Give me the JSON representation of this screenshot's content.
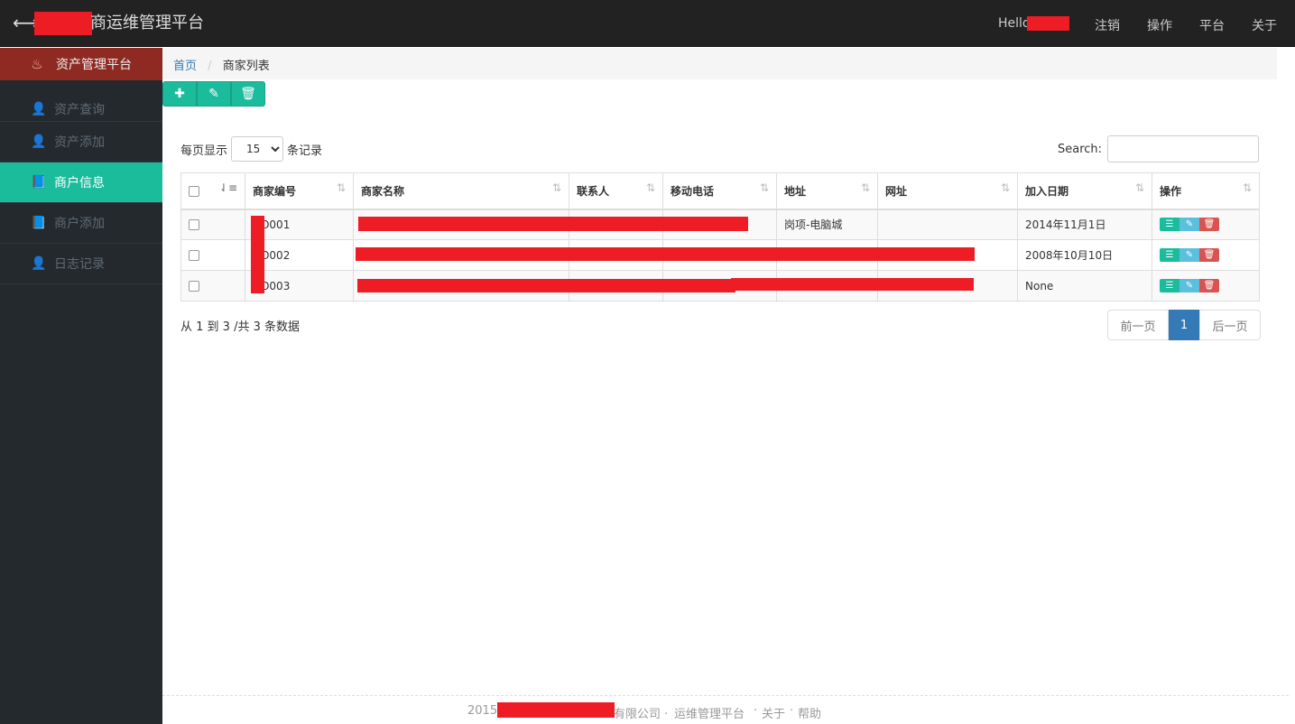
{
  "navbar": {
    "toggle_icon": "arrows-h-icon",
    "brand": "商运维管理平台",
    "hello": "Hello",
    "items": [
      "注销",
      "操作",
      "平台",
      "关于"
    ]
  },
  "sidebar": {
    "header": {
      "label": "资产管理平台",
      "icon": "fire-icon"
    },
    "items": [
      {
        "label": "资产查询",
        "icon": "user-icon"
      },
      {
        "label": "资产添加",
        "icon": "user-icon"
      },
      {
        "label": "商户信息",
        "icon": "book-icon",
        "active": true
      },
      {
        "label": "商户添加",
        "icon": "book-icon"
      },
      {
        "label": "日志记录",
        "icon": "user-icon"
      }
    ]
  },
  "breadcrumb": {
    "home": "首页",
    "separator": "/",
    "current": "商家列表"
  },
  "toolbar": {
    "add_icon": "plus-icon",
    "edit_icon": "edit-icon",
    "delete_icon": "trash-icon"
  },
  "table_controls": {
    "length_prefix": "每页显示",
    "length_value": "15",
    "length_suffix": "条记录",
    "search_label": "Search:"
  },
  "table": {
    "headers": [
      "商家编号",
      "商家名称",
      "联系人",
      "移动电话",
      "地址",
      "网址",
      "加入日期",
      "操作"
    ],
    "rows": [
      {
        "code": "NO001",
        "name": "",
        "contact": "",
        "phone": "",
        "address": "岗项-电脑城",
        "website": "",
        "date": "2014年11月1日"
      },
      {
        "code": "NO002",
        "name": "",
        "contact": "",
        "phone": "",
        "address": "",
        "website": "",
        "date": "2008年10月10日"
      },
      {
        "code": "NO003",
        "name": "",
        "contact": "",
        "phone": "",
        "address": "",
        "website": "",
        "date": "None"
      }
    ]
  },
  "info": "从 1 到 3 /共 3 条数据",
  "pagination": {
    "prev": "前一页",
    "current": "1",
    "next": "后一页"
  },
  "footer": {
    "year": "2015",
    "company_suffix": "有限公司 ·",
    "platform_link": "运维管理平台",
    "dot": "·",
    "about_link": "关于",
    "help_link": "帮助"
  },
  "colors": {
    "accent": "#1abc9c",
    "sidebar_bg": "#24292d",
    "sidebar_header": "#8e2a22",
    "navbar_bg": "#222222",
    "link": "#337ab7",
    "danger": "#d9534f",
    "info": "#5bc0de"
  }
}
